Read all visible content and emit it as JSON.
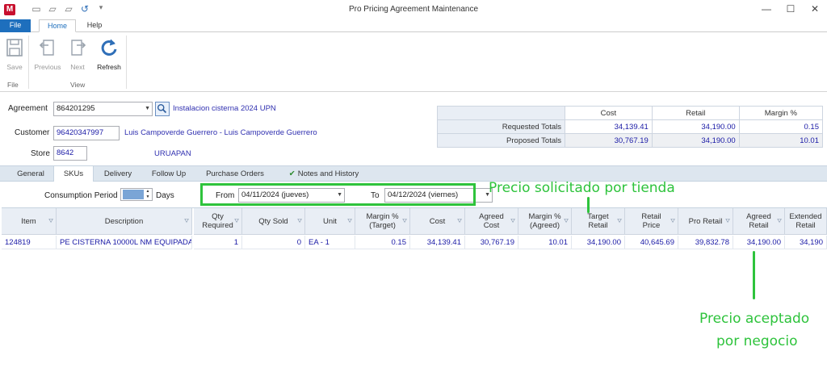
{
  "app": {
    "icon_letter": "M",
    "title": "Pro Pricing Agreement Maintenance"
  },
  "window_controls": {
    "minimize": "—",
    "maximize": "☐",
    "close": "✕"
  },
  "ribbon": {
    "tabs": [
      {
        "label": "File"
      },
      {
        "label": "Home"
      },
      {
        "label": "Help"
      }
    ],
    "buttons": [
      {
        "label": "Save",
        "icon": "save-icon",
        "enabled": false
      },
      {
        "label": "Previous",
        "icon": "previous-icon",
        "enabled": false
      },
      {
        "label": "Next",
        "icon": "next-icon",
        "enabled": false
      },
      {
        "label": "Refresh",
        "icon": "refresh-icon",
        "enabled": true
      }
    ],
    "groups": [
      {
        "label": "File"
      },
      {
        "label": "View"
      }
    ]
  },
  "header": {
    "agreement_label": "Agreement",
    "agreement_value": "864201295",
    "agreement_desc": "Instalacion cisterna 2024 UPN",
    "customer_label": "Customer",
    "customer_value": "96420347997",
    "customer_name": "Luis Campoverde Guerrero - Luis Campoverde Guerrero",
    "store_label": "Store",
    "store_value": "8642",
    "store_name": "URUAPAN"
  },
  "totals": {
    "columns": [
      "Cost",
      "Retail",
      "Margin %"
    ],
    "rows": [
      {
        "label": "Requested Totals",
        "cost": "34,139.41",
        "retail": "34,190.00",
        "margin": "0.15"
      },
      {
        "label": "Proposed Totals",
        "cost": "30,767.19",
        "retail": "34,190.00",
        "margin": "10.01"
      }
    ]
  },
  "content_tabs": [
    {
      "label": "General"
    },
    {
      "label": "SKUs"
    },
    {
      "label": "Delivery"
    },
    {
      "label": "Follow Up"
    },
    {
      "label": "Purchase Orders"
    },
    {
      "label": "Notes and History"
    }
  ],
  "filters": {
    "consumption_label": "Consumption Period",
    "days_label": "Days",
    "from_label": "From",
    "from_value": "04/11/2024 (jueves)",
    "to_label": "To",
    "to_value": "04/12/2024 (viernes)"
  },
  "grid": {
    "columns": [
      "Item",
      "Description",
      "Qty Required",
      "Qty Sold",
      "Unit",
      "Margin % (Target)",
      "Cost",
      "Agreed Cost",
      "Margin % (Agreed)",
      "Target Retail",
      "Retail Price",
      "Pro Retail",
      "Agreed Retail",
      "Extended Retail"
    ],
    "rows": [
      [
        "124819",
        "PE CISTERNA 10000L NM EQUIPADA",
        "1",
        "0",
        "EA - 1",
        "0.15",
        "34,139.41",
        "30,767.19",
        "10.01",
        "34,190.00",
        "40,645.69",
        "39,832.78",
        "34,190.00",
        "34,190"
      ]
    ]
  },
  "annotations": {
    "store_price": "Precio solicitado por tienda",
    "accepted_price_line1": "Precio aceptado",
    "accepted_price_line2": "por negocio"
  }
}
